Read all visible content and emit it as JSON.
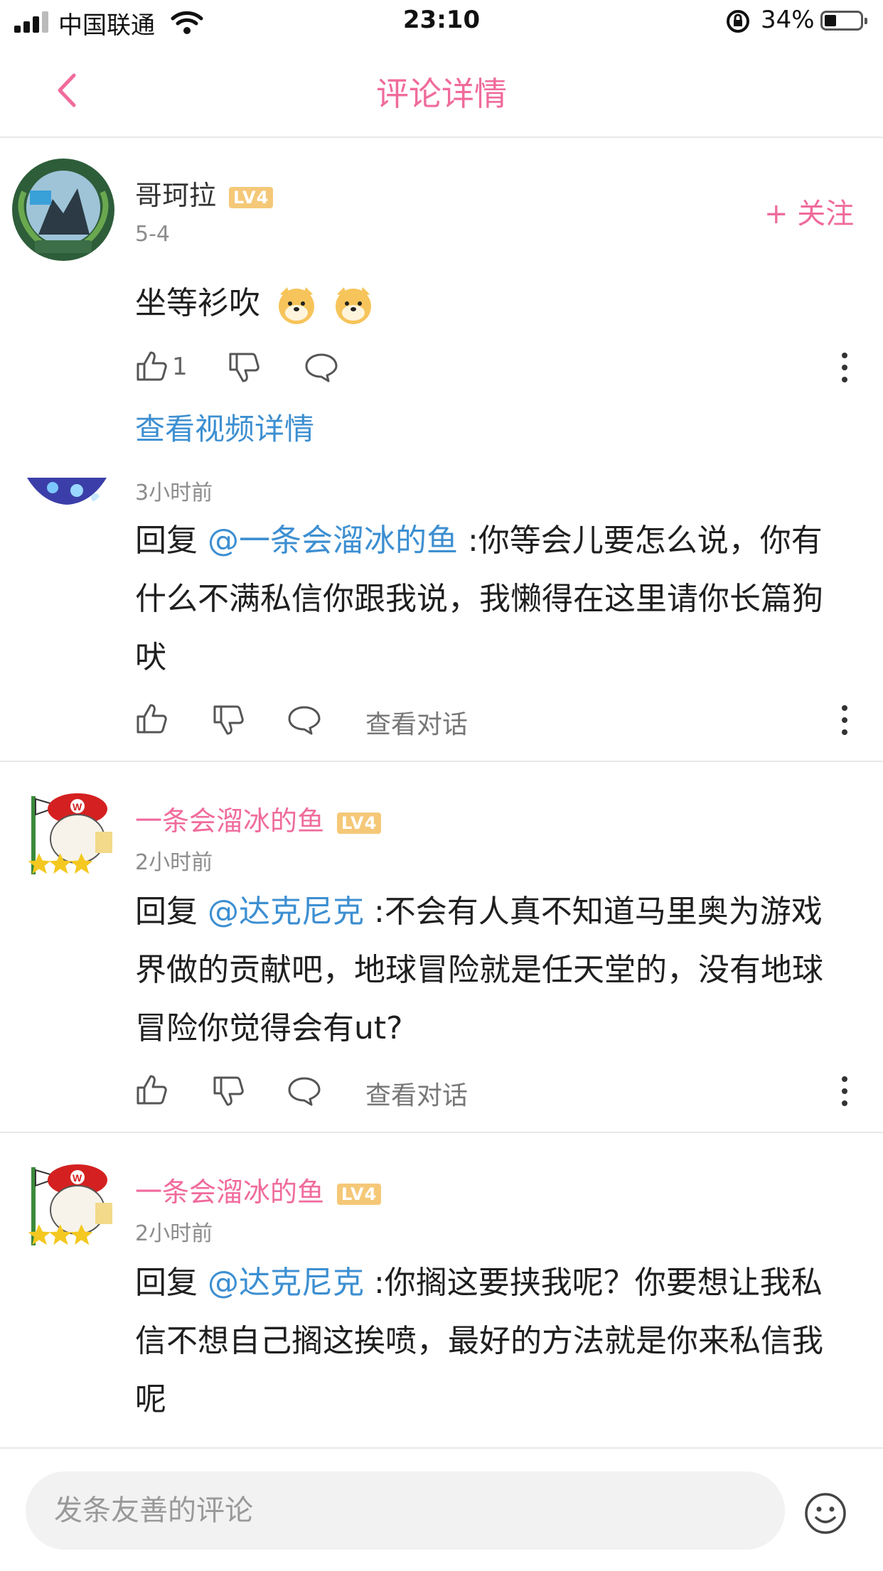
{
  "status_bar": {
    "carrier": "中国联通",
    "time": "23:10",
    "battery": "34%"
  },
  "nav": {
    "title": "评论详情"
  },
  "main_comment": {
    "username": "哥珂拉",
    "level": "LV4",
    "date": "5-4",
    "follow_label": "+ 关注",
    "text": "坐等衫吹",
    "like_count": "1",
    "video_link": "查看视频详情"
  },
  "replies": [
    {
      "time": "3小时前",
      "prefix": "回复 ",
      "mention": "@一条会溜冰的鱼",
      "text": " :你等会儿要怎么说，你有什么不满私信你跟我说，我懒得在这里请你长篇狗吠",
      "convo_label": "查看对话"
    },
    {
      "username": "一条会溜冰的鱼",
      "level": "LV4",
      "time": "2小时前",
      "prefix": "回复 ",
      "mention": "@达克尼克",
      "text": " :不会有人真不知道马里奥为游戏界做的贡献吧，地球冒险就是任天堂的，没有地球冒险你觉得会有ut?",
      "convo_label": "查看对话"
    },
    {
      "username": "一条会溜冰的鱼",
      "level": "LV4",
      "time": "2小时前",
      "prefix": "回复 ",
      "mention": "@达克尼克",
      "text": " :你搁这要挟我呢？你要想让我私信不想自己搁这挨喷，最好的方法就是你来私信我呢"
    }
  ],
  "input": {
    "placeholder": "发条友善的评论"
  },
  "colors": {
    "accent_pink": "#f06b9c",
    "mention_blue": "#3d8fd1",
    "level_badge": "#f5c878"
  }
}
